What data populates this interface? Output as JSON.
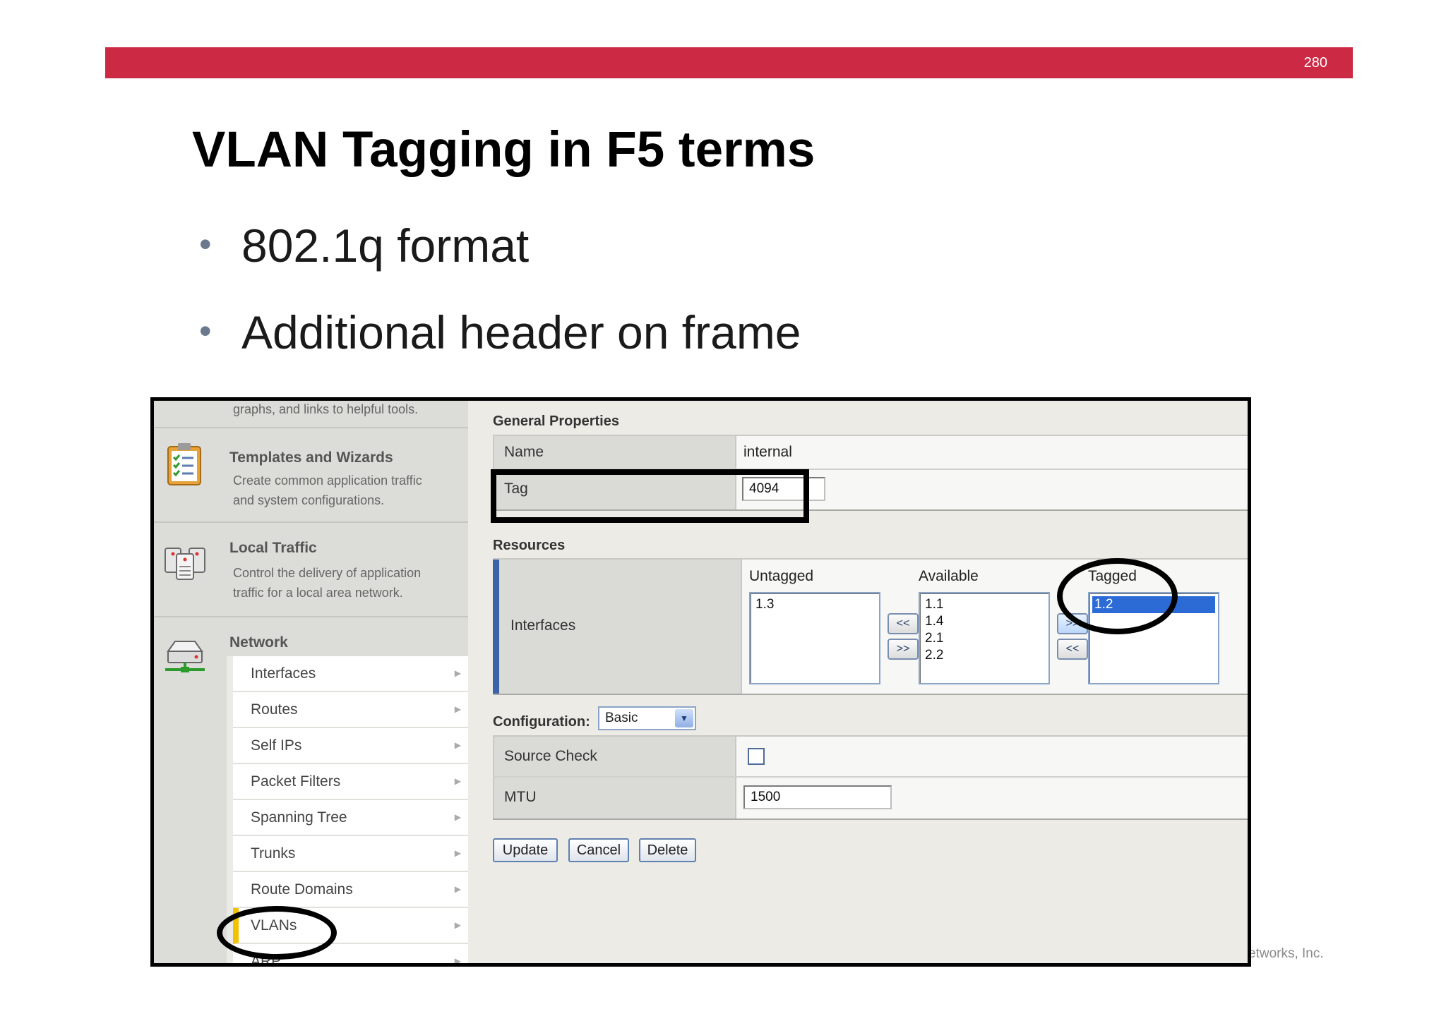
{
  "slide": {
    "page_number": "280",
    "title": "VLAN Tagging in F5 terms",
    "bullets": [
      "802.1q format",
      "Additional header on frame"
    ],
    "footer": "etworks, Inc.",
    "accent_color": "#cc2944"
  },
  "screenshot": {
    "nav": {
      "top_snippet": "graphs, and links to helpful tools.",
      "sections": [
        {
          "icon": "clipboard-checklist-icon",
          "title": "Templates and Wizards",
          "desc": [
            "Create common application traffic",
            "and system configurations."
          ]
        },
        {
          "icon": "servers-icon",
          "title": "Local Traffic",
          "desc": [
            "Control the delivery of application",
            "traffic for a local area network."
          ]
        },
        {
          "icon": "network-device-icon",
          "title": "Network",
          "desc": []
        }
      ],
      "network_items": [
        "Interfaces",
        "Routes",
        "Self IPs",
        "Packet Filters",
        "Spanning Tree",
        "Trunks",
        "Route Domains",
        "VLANs",
        "ARP"
      ],
      "active_item": "VLANs"
    },
    "general_properties": {
      "title": "General Properties",
      "name_label": "Name",
      "name_value": "internal",
      "tag_label": "Tag",
      "tag_value": "4094"
    },
    "resources": {
      "title": "Resources",
      "interfaces_label": "Interfaces",
      "untagged_header": "Untagged",
      "untagged": [
        "1.3"
      ],
      "available_header": "Available",
      "available": [
        "1.1",
        "1.4",
        "2.1",
        "2.2"
      ],
      "tagged_header": "Tagged",
      "tagged": [
        "1.2"
      ],
      "move_left": "<<",
      "move_right": ">>"
    },
    "configuration": {
      "label": "Configuration:",
      "value": "Basic",
      "source_check_label": "Source Check",
      "source_check": false,
      "mtu_label": "MTU",
      "mtu_value": "1500"
    },
    "buttons": {
      "update": "Update",
      "cancel": "Cancel",
      "delete": "Delete"
    }
  }
}
